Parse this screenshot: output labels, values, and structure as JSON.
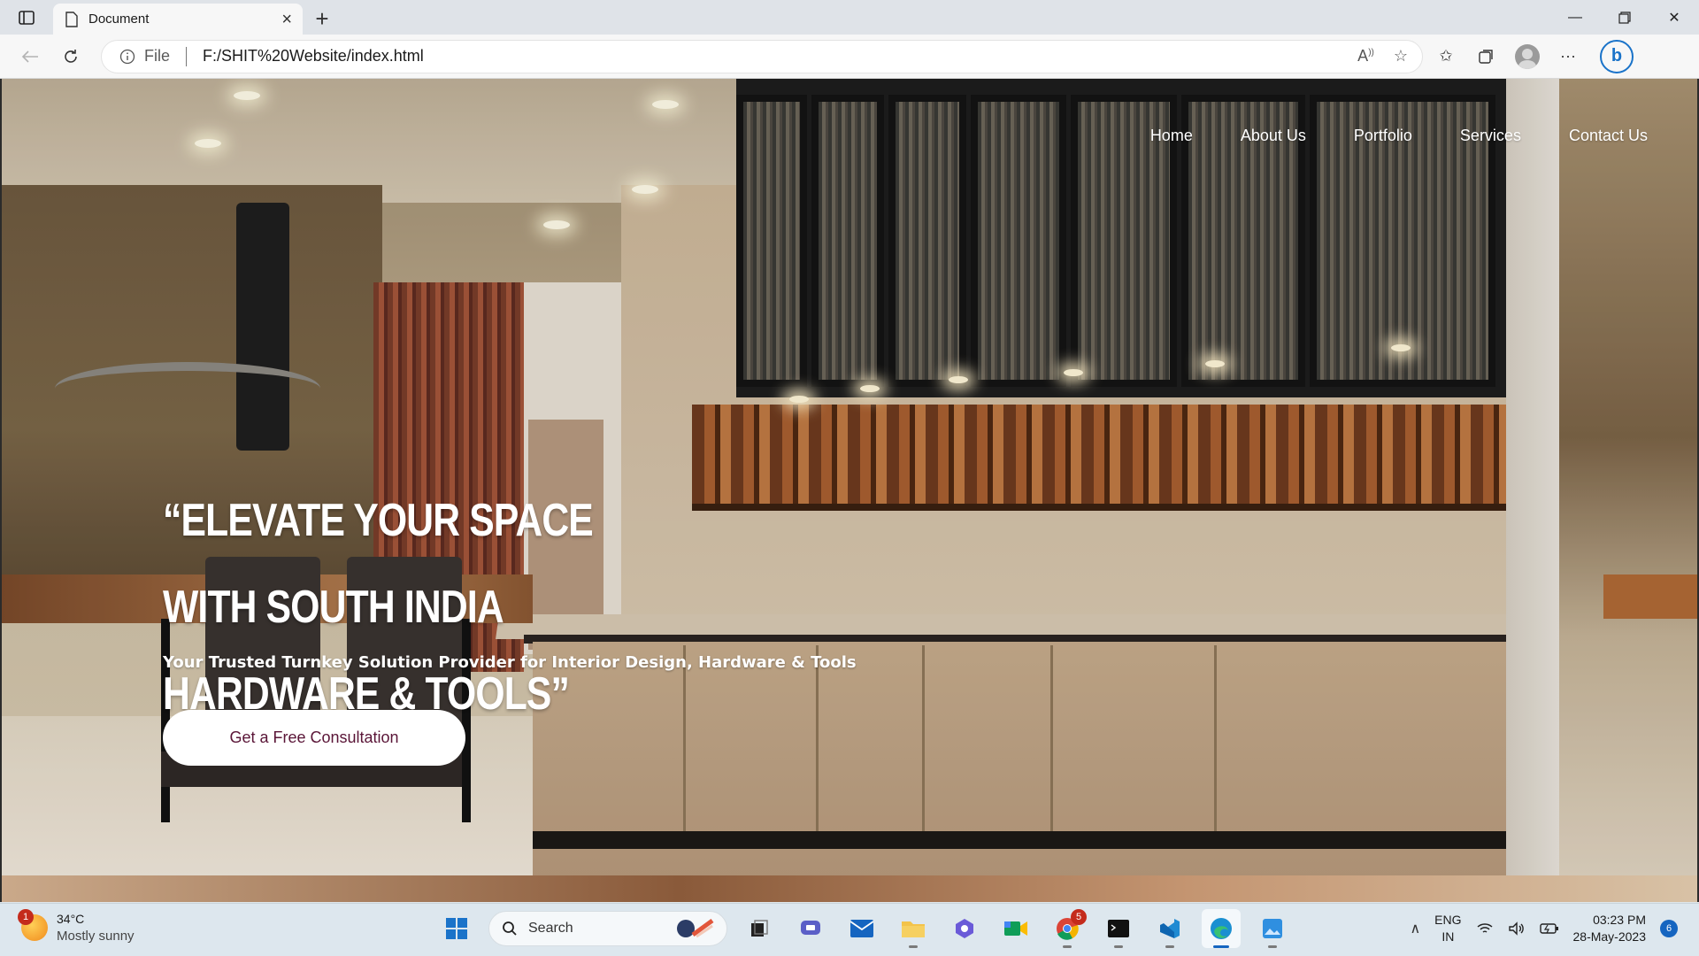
{
  "browser": {
    "tab_title": "Document",
    "address_prefix": "File",
    "url": "F:/SHIT%20Website/index.html"
  },
  "site": {
    "nav": [
      "Home",
      "About Us",
      "Portfolio",
      "Services",
      "Contact Us"
    ],
    "hero_title": "“ELEVATE YOUR SPACE WITH SOUTH INDIA HARDWARE & TOOLS”",
    "hero_subtitle": "Your Trusted Turnkey Solution Provider for Interior Design, Hardware & Tools",
    "cta_label": "Get a Free Consultation",
    "cta_text_color": "#5a1537"
  },
  "taskbar": {
    "weather_temp": "34°C",
    "weather_desc": "Mostly sunny",
    "weather_badge": "1",
    "search_label": "Search",
    "chrome_badge": "5",
    "lang_line1": "ENG",
    "lang_line2": "IN",
    "time": "03:23 PM",
    "date": "28-May-2023",
    "notification_count": "6"
  }
}
